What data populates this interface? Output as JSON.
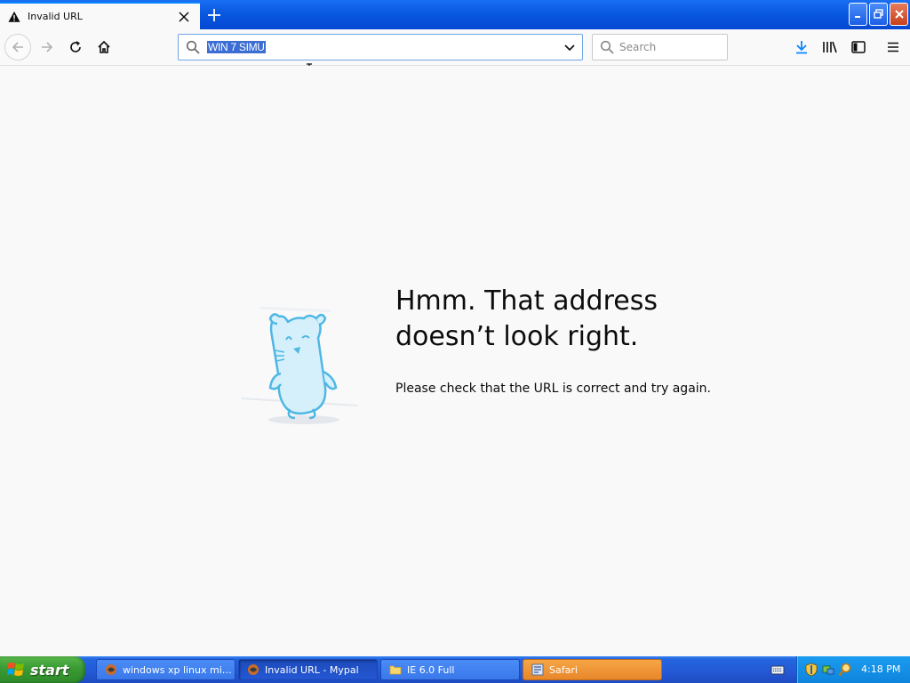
{
  "browser": {
    "tab": {
      "title": "Invalid URL",
      "icon": "warning-icon"
    },
    "url": {
      "value": "WIN 7 SIMU"
    },
    "search": {
      "placeholder": "Search"
    }
  },
  "error_page": {
    "title_line1": "Hmm. That address",
    "title_line2": "doesn’t look right.",
    "description": "Please check that the URL is correct and try again."
  },
  "taskbar": {
    "start_label": "start",
    "tasks": [
      {
        "label": "windows xp linux mint...",
        "icon": "browser-icon"
      },
      {
        "label": "Invalid URL - Mypal",
        "icon": "browser-icon"
      },
      {
        "label": "IE 6.0 Full",
        "icon": "folder-icon"
      },
      {
        "label": "Safari",
        "icon": "app-icon"
      }
    ],
    "clock": "4:18 PM"
  },
  "colors": {
    "accent": "#0a84ff",
    "selection": "#3b6dd3",
    "taskbar": "#2458d4",
    "start": "#3a9a34"
  }
}
